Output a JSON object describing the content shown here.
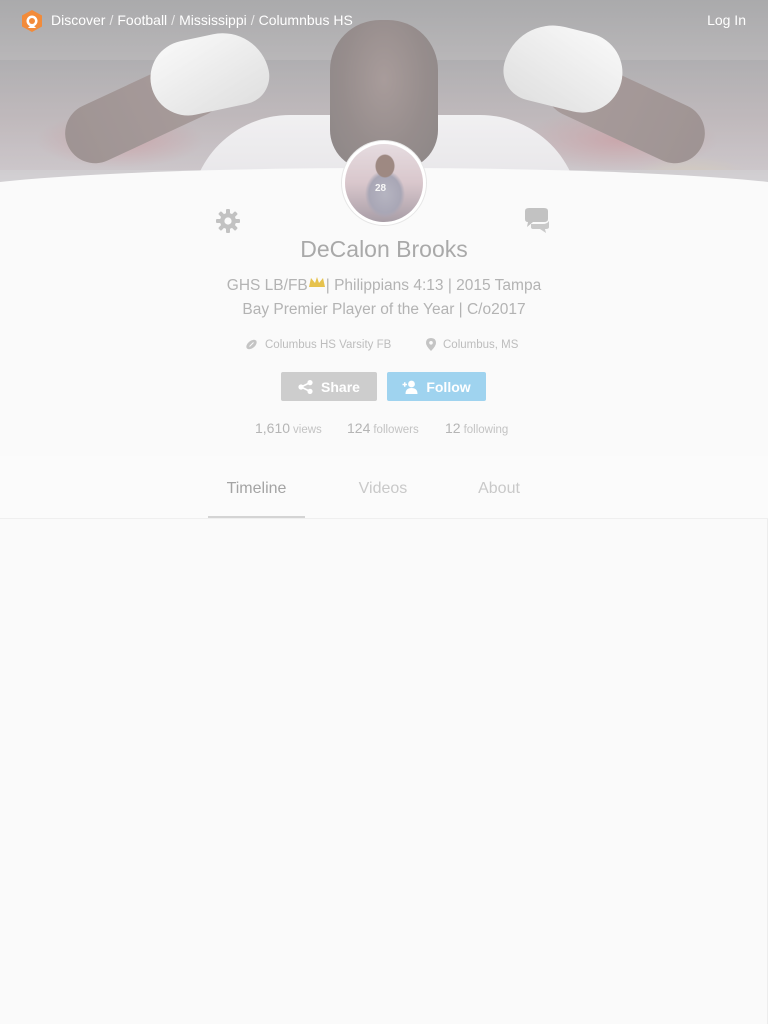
{
  "nav": {
    "breadcrumb": [
      "Discover",
      "Football",
      "Mississippi",
      "Columnbus HS"
    ],
    "separator": "/",
    "login_label": "Log In",
    "logo_icon": "hudl-logo-icon"
  },
  "profile": {
    "name": "DeCalon Brooks",
    "bio_line1_start": "GHS LB/FB",
    "bio_line1_end": "| Philippians 4:13 | 2015 Tampa",
    "bio_line2": "Bay Premier Player of the Year | C/o2017",
    "team": "Columbus HS Varsity FB",
    "location": "Columbus, MS",
    "avatar_jersey_number": "28"
  },
  "actions": {
    "share_label": "Share",
    "follow_label": "Follow"
  },
  "stats": {
    "views_value": "1,610",
    "views_label": "views",
    "followers_value": "124",
    "followers_label": "followers",
    "following_value": "12",
    "following_label": "following"
  },
  "tabs": [
    {
      "label": "Timeline",
      "active": true
    },
    {
      "label": "Videos",
      "active": false
    },
    {
      "label": "About",
      "active": false
    }
  ],
  "colors": {
    "follow_button": "#9fd3ef",
    "share_button": "#cdcdcd",
    "logo_orange": "#f28b3a"
  }
}
